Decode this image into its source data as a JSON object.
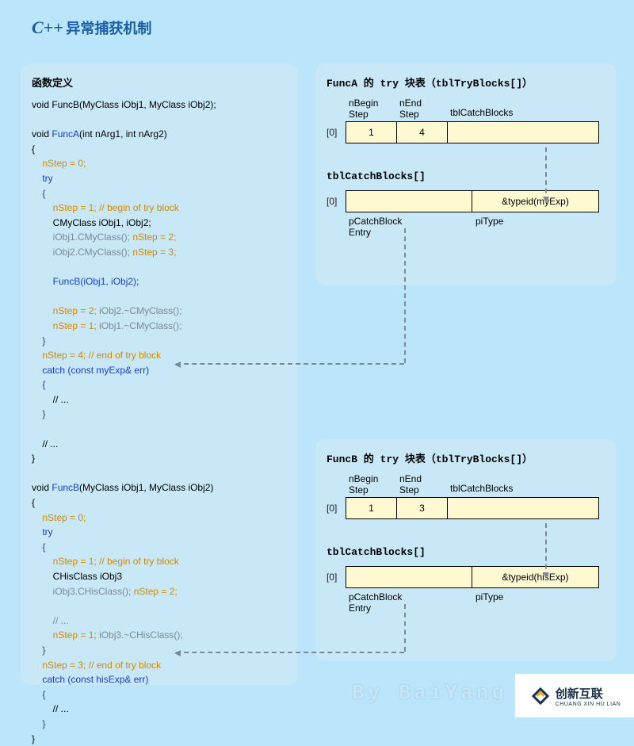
{
  "title": {
    "cpp": "C++",
    "zh": "异常捕获机制"
  },
  "left": {
    "heading": "函数定义",
    "code_html": "void FuncB(MyClass iObj1, MyClass iObj2);\n\nvoid <span class='c-kw'>FuncA</span>(int nArg1, int nArg2)\n{\n    <span class='c-orange'>nStep = 0;</span>\n    <span class='c-kw'>try</span>\n    <span class='c-kw'>{</span>\n        <span class='c-orange'>nStep = 1;</span> <span class='c-orange'>// begin of try block</span>\n        CMyClass iObj1, iObj2;\n        <span class='c-grey'>iObj1.CMyClass();</span> <span class='c-orange'>nStep = 2;</span>\n        <span class='c-grey'>iObj2.CMyClass();</span> <span class='c-orange'>nStep = 3;</span>\n\n        <span class='c-kw'>FuncB(iObj1, iObj2);</span>\n\n        <span class='c-orange'>nStep = 2;</span> <span class='c-grey'>iObj2.~CMyClass();</span>\n        <span class='c-orange'>nStep = 1;</span> <span class='c-grey'>iObj1.~CMyClass();</span>\n    <span class='c-kw'>}</span>\n    <span class='c-orange'>nStep = 4;</span> <span class='c-orange'>// end of try block</span>\n    <span class='c-kw'>catch</span> <span class='c-kw'>(const myExp& err)</span>\n    <span class='c-kw'>{</span>\n        // ...\n    <span class='c-kw'>}</span>\n\n    // ...\n}\n\nvoid <span class='c-kw'>FuncB</span>(MyClass iObj1, MyClass iObj2)\n{\n    <span class='c-orange'>nStep = 0;</span>\n    <span class='c-kw'>try</span>\n    <span class='c-kw'>{</span>\n        <span class='c-orange'>nStep = 1;</span> <span class='c-orange'>// begin of try block</span>\n        CHisClass iObj3\n        <span class='c-grey'>iObj3.CHisClass();</span> <span class='c-orange'>nStep = 2;</span>\n\n        <span class='c-grey'>// ...</span>\n        <span class='c-orange'>nStep = 1;</span> <span class='c-grey'>iObj3.~CHisClass();</span>\n    <span class='c-kw'>}</span>\n    <span class='c-orange'>nStep = 3;</span> <span class='c-orange'>// end of try block</span>\n    <span class='c-kw'>catch</span> <span class='c-kw'>(const hisExp& err)</span>\n    <span class='c-kw'>{</span>\n        // ...\n    <span class='c-kw'>}</span>\n}"
  },
  "rightA": {
    "heading": "FuncA 的 try 块表（tblTryBlocks[]）",
    "col1": "nBegin\nStep",
    "col2": "nEnd\nStep",
    "col3": "tblCatchBlocks",
    "idx": "[0]",
    "v1": "1",
    "v2": "4",
    "sub_heading": "tblCatchBlocks[]",
    "sub_idx": "[0]",
    "sub_v2": "&typeid(myExp)",
    "sub_l1": "pCatchBlock\nEntry",
    "sub_l2": "piType"
  },
  "rightB": {
    "heading": "FuncB 的 try 块表（tblTryBlocks[]）",
    "col1": "nBegin\nStep",
    "col2": "nEnd\nStep",
    "col3": "tblCatchBlocks",
    "idx": "[0]",
    "v1": "1",
    "v2": "3",
    "sub_heading": "tblCatchBlocks[]",
    "sub_idx": "[0]",
    "sub_v2": "&typeid(hisExp)",
    "sub_l1": "pCatchBlock\nEntry",
    "sub_l2": "piType"
  },
  "byline": "By BaiYang",
  "watermark": {
    "zh": "创新互联",
    "py": "CHUANG XIN HU LIAN"
  }
}
